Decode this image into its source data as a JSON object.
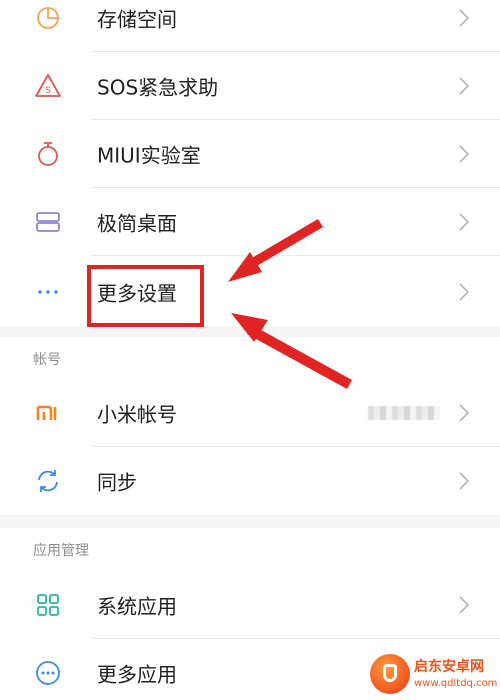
{
  "settings_list": {
    "items": [
      {
        "label": "存储空间",
        "icon": "storage-pie-icon"
      },
      {
        "label": "SOS紧急求助",
        "icon": "sos-warning-icon"
      },
      {
        "label": "MIUI实验室",
        "icon": "lab-flask-icon"
      },
      {
        "label": "极简桌面",
        "icon": "minimal-desktop-icon"
      },
      {
        "label": "更多设置",
        "icon": "more-dots-icon"
      }
    ]
  },
  "account_section": {
    "header": "帐号",
    "items": [
      {
        "label": "小米帐号",
        "icon": "mi-logo-icon"
      },
      {
        "label": "同步",
        "icon": "sync-icon"
      }
    ]
  },
  "app_management_section": {
    "header": "应用管理",
    "items": [
      {
        "label": "系统应用",
        "icon": "system-apps-grid-icon"
      },
      {
        "label": "更多应用",
        "icon": "more-apps-icon"
      }
    ]
  },
  "watermark": {
    "title": "启东安卓网",
    "url": "www.qdltdq.com"
  },
  "colors": {
    "highlight": "#e02424",
    "mi_orange": "#f5821f",
    "icon_blue": "#3b8be8",
    "icon_teal": "#2ab5a5",
    "icon_red": "#e2564d",
    "icon_purple": "#8a84d6"
  }
}
